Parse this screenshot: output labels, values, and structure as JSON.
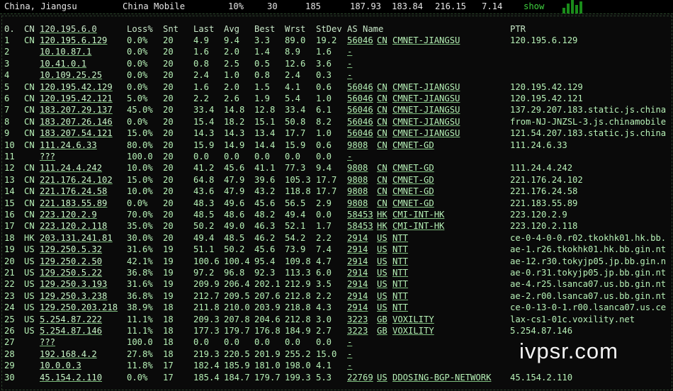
{
  "topbar": {
    "location": "China, Jiangsu",
    "isp": "China Mobile",
    "loss": "10%",
    "snt": "30",
    "hops": "185",
    "v1": "187.93",
    "v2": "183.84",
    "v3": "216.15",
    "v4": "7.14",
    "show_label": "show"
  },
  "headers": {
    "hop": "0.",
    "cc": "CN",
    "host": "120.195.6.0",
    "loss": "Loss%",
    "snt": "Snt",
    "last": "Last",
    "avg": "Avg",
    "best": "Best",
    "wrst": "Wrst",
    "stdev": "StDev",
    "as_name": "AS Name",
    "ptr": "PTR"
  },
  "rows": [
    {
      "hop": "1",
      "cc": "CN",
      "host": "120.195.6.129",
      "loss": "0.0%",
      "snt": "20",
      "last": "4.9",
      "avg": "9.4",
      "best": "3.3",
      "wrst": "89.0",
      "stdev": "19.2",
      "asn": "56046",
      "ascc": "CN",
      "asname": "CMNET-JIANGSU",
      "ptr": "120.195.6.129"
    },
    {
      "hop": "2",
      "cc": "",
      "host": "10.10.87.1",
      "loss": "0.0%",
      "snt": "20",
      "last": "1.6",
      "avg": "2.0",
      "best": "1.4",
      "wrst": "8.9",
      "stdev": "1.6",
      "asn": "",
      "ascc": "",
      "asname": "-",
      "ptr": ""
    },
    {
      "hop": "3",
      "cc": "",
      "host": "10.41.0.1",
      "loss": "0.0%",
      "snt": "20",
      "last": "0.8",
      "avg": "2.5",
      "best": "0.5",
      "wrst": "12.6",
      "stdev": "3.6",
      "asn": "",
      "ascc": "",
      "asname": "-",
      "ptr": ""
    },
    {
      "hop": "4",
      "cc": "",
      "host": "10.109.25.25",
      "loss": "0.0%",
      "snt": "20",
      "last": "2.4",
      "avg": "1.0",
      "best": "0.8",
      "wrst": "2.4",
      "stdev": "0.3",
      "asn": "",
      "ascc": "",
      "asname": "-",
      "ptr": ""
    },
    {
      "hop": "5",
      "cc": "CN",
      "host": "120.195.42.129",
      "loss": "0.0%",
      "snt": "20",
      "last": "1.6",
      "avg": "2.0",
      "best": "1.5",
      "wrst": "4.1",
      "stdev": "0.6",
      "asn": "56046",
      "ascc": "CN",
      "asname": "CMNET-JIANGSU",
      "ptr": "120.195.42.129"
    },
    {
      "hop": "6",
      "cc": "CN",
      "host": "120.195.42.121",
      "loss": "5.0%",
      "snt": "20",
      "last": "2.2",
      "avg": "2.6",
      "best": "1.9",
      "wrst": "5.4",
      "stdev": "1.0",
      "asn": "56046",
      "ascc": "CN",
      "asname": "CMNET-JIANGSU",
      "ptr": "120.195.42.121"
    },
    {
      "hop": "7",
      "cc": "CN",
      "host": "183.207.29.137",
      "loss": "45.0%",
      "snt": "20",
      "last": "33.4",
      "avg": "14.8",
      "best": "12.8",
      "wrst": "33.4",
      "stdev": "6.1",
      "asn": "56046",
      "ascc": "CN",
      "asname": "CMNET-JIANGSU",
      "ptr": "137.29.207.183.static.js.china"
    },
    {
      "hop": "8",
      "cc": "CN",
      "host": "183.207.26.146",
      "loss": "0.0%",
      "snt": "20",
      "last": "15.4",
      "avg": "18.2",
      "best": "15.1",
      "wrst": "50.8",
      "stdev": "8.2",
      "asn": "56046",
      "ascc": "CN",
      "asname": "CMNET-JIANGSU",
      "ptr": "from-NJ-JNZSL-3.js.chinamobile"
    },
    {
      "hop": "9",
      "cc": "CN",
      "host": "183.207.54.121",
      "loss": "15.0%",
      "snt": "20",
      "last": "14.3",
      "avg": "14.3",
      "best": "13.4",
      "wrst": "17.7",
      "stdev": "1.0",
      "asn": "56046",
      "ascc": "CN",
      "asname": "CMNET-JIANGSU",
      "ptr": "121.54.207.183.static.js.china"
    },
    {
      "hop": "10",
      "cc": "CN",
      "host": "111.24.6.33",
      "loss": "80.0%",
      "snt": "20",
      "last": "15.9",
      "avg": "14.9",
      "best": "14.4",
      "wrst": "15.9",
      "stdev": "0.6",
      "asn": "9808",
      "ascc": "CN",
      "asname": "CMNET-GD",
      "ptr": "111.24.6.33"
    },
    {
      "hop": "11",
      "cc": "",
      "host": "???",
      "loss": "100.0",
      "snt": "20",
      "last": "0.0",
      "avg": "0.0",
      "best": "0.0",
      "wrst": "0.0",
      "stdev": "0.0",
      "asn": "",
      "ascc": "",
      "asname": "-",
      "ptr": ""
    },
    {
      "hop": "12",
      "cc": "CN",
      "host": "111.24.4.242",
      "loss": "10.0%",
      "snt": "20",
      "last": "41.2",
      "avg": "45.6",
      "best": "41.1",
      "wrst": "77.3",
      "stdev": "9.4",
      "asn": "9808",
      "ascc": "CN",
      "asname": "CMNET-GD",
      "ptr": "111.24.4.242"
    },
    {
      "hop": "13",
      "cc": "CN",
      "host": "221.176.24.102",
      "loss": "15.0%",
      "snt": "20",
      "last": "64.8",
      "avg": "47.9",
      "best": "39.6",
      "wrst": "105.3",
      "stdev": "17.7",
      "asn": "9808",
      "ascc": "CN",
      "asname": "CMNET-GD",
      "ptr": "221.176.24.102"
    },
    {
      "hop": "14",
      "cc": "CN",
      "host": "221.176.24.58",
      "loss": "10.0%",
      "snt": "20",
      "last": "43.6",
      "avg": "47.9",
      "best": "43.2",
      "wrst": "118.8",
      "stdev": "17.7",
      "asn": "9808",
      "ascc": "CN",
      "asname": "CMNET-GD",
      "ptr": "221.176.24.58"
    },
    {
      "hop": "15",
      "cc": "CN",
      "host": "221.183.55.89",
      "loss": "0.0%",
      "snt": "20",
      "last": "48.3",
      "avg": "49.6",
      "best": "45.6",
      "wrst": "56.5",
      "stdev": "2.9",
      "asn": "9808",
      "ascc": "CN",
      "asname": "CMNET-GD",
      "ptr": "221.183.55.89"
    },
    {
      "hop": "16",
      "cc": "CN",
      "host": "223.120.2.9",
      "loss": "70.0%",
      "snt": "20",
      "last": "48.5",
      "avg": "48.6",
      "best": "48.2",
      "wrst": "49.4",
      "stdev": "0.0",
      "asn": "58453",
      "ascc": "HK",
      "asname": "CMI-INT-HK",
      "ptr": "223.120.2.9"
    },
    {
      "hop": "17",
      "cc": "CN",
      "host": "223.120.2.118",
      "loss": "35.0%",
      "snt": "20",
      "last": "50.2",
      "avg": "49.0",
      "best": "46.3",
      "wrst": "52.1",
      "stdev": "1.7",
      "asn": "58453",
      "ascc": "HK",
      "asname": "CMI-INT-HK",
      "ptr": "223.120.2.118"
    },
    {
      "hop": "18",
      "cc": "HK",
      "host": "203.131.241.81",
      "loss": "30.0%",
      "snt": "20",
      "last": "49.4",
      "avg": "48.5",
      "best": "46.2",
      "wrst": "54.2",
      "stdev": "2.2",
      "asn": "2914",
      "ascc": "US",
      "asname": "NTT",
      "ptr": "ce-0-4-0-0.r02.tkokhk01.hk.bb."
    },
    {
      "hop": "19",
      "cc": "US",
      "host": "129.250.5.32",
      "loss": "31.6%",
      "snt": "19",
      "last": "51.1",
      "avg": "50.2",
      "best": "45.6",
      "wrst": "73.9",
      "stdev": "7.4",
      "asn": "2914",
      "ascc": "US",
      "asname": "NTT",
      "ptr": "ae-1.r26.tkokhk01.hk.bb.gin.nt"
    },
    {
      "hop": "20",
      "cc": "US",
      "host": "129.250.2.50",
      "loss": "42.1%",
      "snt": "19",
      "last": "100.6",
      "avg": "100.4",
      "best": "95.4",
      "wrst": "109.8",
      "stdev": "4.7",
      "asn": "2914",
      "ascc": "US",
      "asname": "NTT",
      "ptr": "ae-12.r30.tokyjp05.jp.bb.gin.n"
    },
    {
      "hop": "21",
      "cc": "US",
      "host": "129.250.5.22",
      "loss": "36.8%",
      "snt": "19",
      "last": "97.2",
      "avg": "96.8",
      "best": "92.3",
      "wrst": "113.3",
      "stdev": "6.0",
      "asn": "2914",
      "ascc": "US",
      "asname": "NTT",
      "ptr": "ae-0.r31.tokyjp05.jp.bb.gin.nt"
    },
    {
      "hop": "22",
      "cc": "US",
      "host": "129.250.3.193",
      "loss": "31.6%",
      "snt": "19",
      "last": "209.9",
      "avg": "206.4",
      "best": "202.1",
      "wrst": "212.9",
      "stdev": "3.5",
      "asn": "2914",
      "ascc": "US",
      "asname": "NTT",
      "ptr": "ae-4.r25.lsanca07.us.bb.gin.nt"
    },
    {
      "hop": "23",
      "cc": "US",
      "host": "129.250.3.238",
      "loss": "36.8%",
      "snt": "19",
      "last": "212.7",
      "avg": "209.5",
      "best": "207.6",
      "wrst": "212.8",
      "stdev": "2.2",
      "asn": "2914",
      "ascc": "US",
      "asname": "NTT",
      "ptr": "ae-2.r00.lsanca07.us.bb.gin.nt"
    },
    {
      "hop": "24",
      "cc": "US",
      "host": "129.250.203.218",
      "loss": "38.9%",
      "snt": "18",
      "last": "211.8",
      "avg": "210.0",
      "best": "203.9",
      "wrst": "218.8",
      "stdev": "4.3",
      "asn": "2914",
      "ascc": "US",
      "asname": "NTT",
      "ptr": "ce-0-13-0-1.r00.lsanca07.us.ce"
    },
    {
      "hop": "25",
      "cc": "US",
      "host": "5.254.87.222",
      "loss": "11.1%",
      "snt": "18",
      "last": "209.3",
      "avg": "207.8",
      "best": "204.6",
      "wrst": "212.8",
      "stdev": "3.0",
      "asn": "3223",
      "ascc": "GB",
      "asname": "VOXILITY",
      "ptr": "lax-cs1-01c.voxility.net"
    },
    {
      "hop": "26",
      "cc": "US",
      "host": "5.254.87.146",
      "loss": "11.1%",
      "snt": "18",
      "last": "177.3",
      "avg": "179.7",
      "best": "176.8",
      "wrst": "184.9",
      "stdev": "2.7",
      "asn": "3223",
      "ascc": "GB",
      "asname": "VOXILITY",
      "ptr": "5.254.87.146"
    },
    {
      "hop": "27",
      "cc": "",
      "host": "???",
      "loss": "100.0",
      "snt": "18",
      "last": "0.0",
      "avg": "0.0",
      "best": "0.0",
      "wrst": "0.0",
      "stdev": "0.0",
      "asn": "",
      "ascc": "",
      "asname": "-",
      "ptr": ""
    },
    {
      "hop": "28",
      "cc": "",
      "host": "192.168.4.2",
      "loss": "27.8%",
      "snt": "18",
      "last": "219.3",
      "avg": "220.5",
      "best": "201.9",
      "wrst": "255.2",
      "stdev": "15.0",
      "asn": "",
      "ascc": "",
      "asname": "-",
      "ptr": ""
    },
    {
      "hop": "29",
      "cc": "",
      "host": "10.0.0.3",
      "loss": "11.8%",
      "snt": "17",
      "last": "182.4",
      "avg": "185.9",
      "best": "181.0",
      "wrst": "198.0",
      "stdev": "4.1",
      "asn": "",
      "ascc": "",
      "asname": "-",
      "ptr": ""
    },
    {
      "hop": "30",
      "cc": "",
      "host": "45.154.2.110",
      "loss": "0.0%",
      "snt": "17",
      "last": "185.4",
      "avg": "184.7",
      "best": "179.7",
      "wrst": "199.3",
      "stdev": "5.3",
      "asn": "22769",
      "ascc": "US",
      "asname": "DDOSING-BGP-NETWORK",
      "ptr": "45.154.2.110"
    }
  ],
  "watermark": "ivpsr.com",
  "colors": {
    "background": "#0a0a0a",
    "text": "#b6f0b6",
    "accent": "#3fd03f"
  }
}
